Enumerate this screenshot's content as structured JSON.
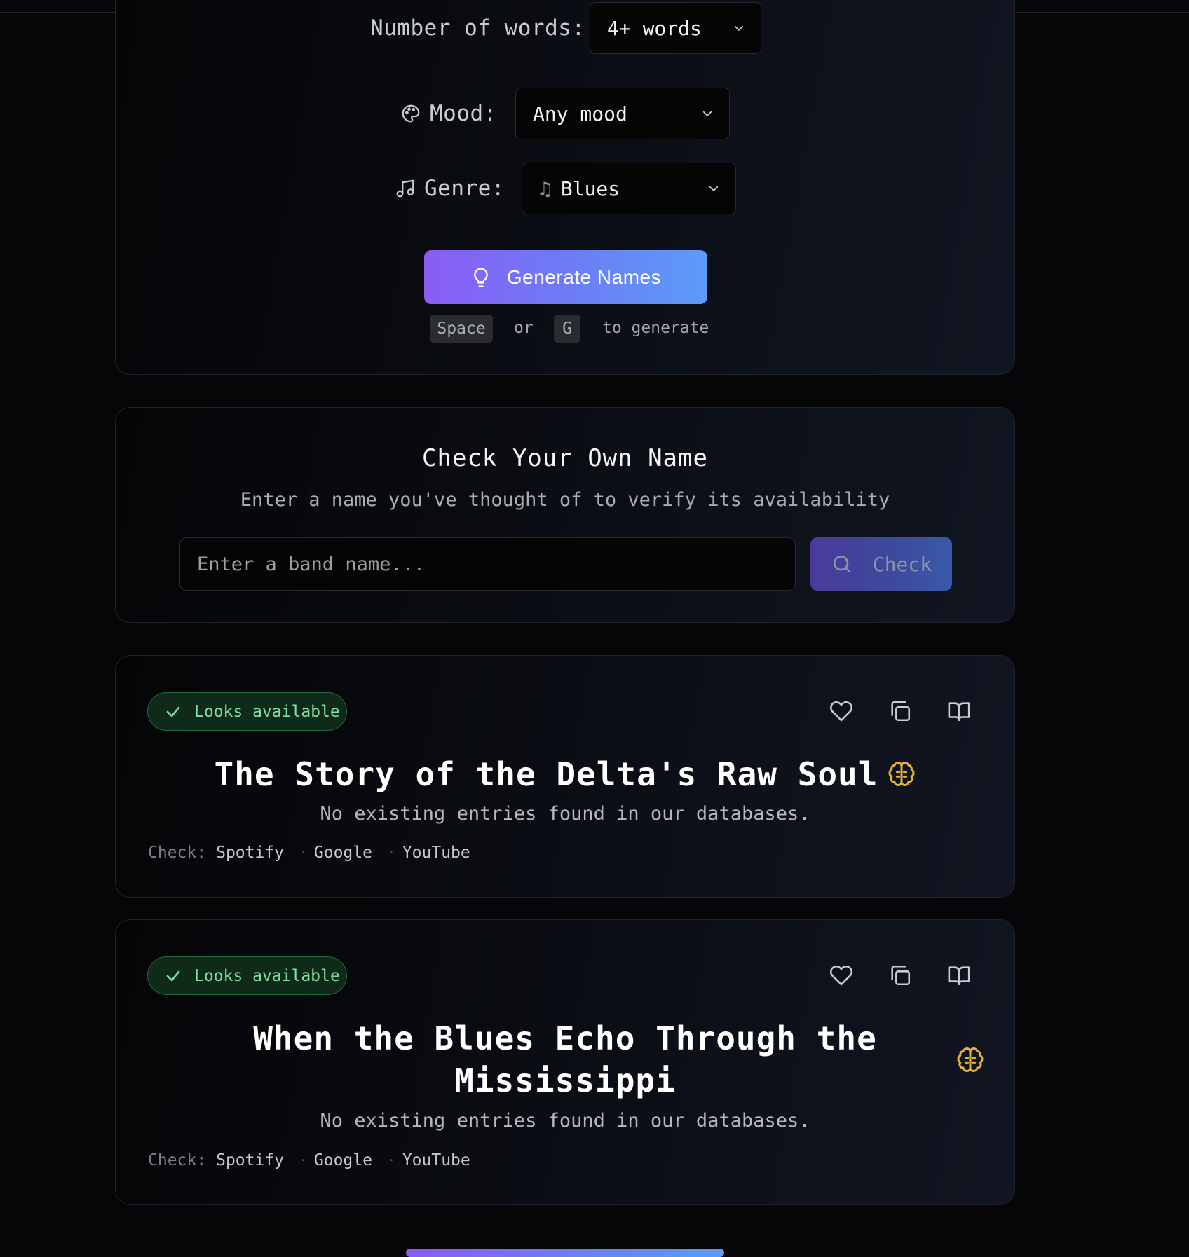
{
  "generator": {
    "words_label": "Number of words:",
    "words_value": "4+ words",
    "mood_label": "Mood:",
    "mood_value": "Any mood",
    "genre_label": "Genre:",
    "genre_value": "Blues",
    "generate_label": "Generate Names",
    "hint_key_1": "Space",
    "hint_or": "or",
    "hint_key_2": "G",
    "hint_tail": "to generate"
  },
  "check": {
    "title": "Check Your Own Name",
    "subtitle": "Enter a name you've thought of to verify its availability",
    "placeholder": "Enter a band name...",
    "button_label": "Check"
  },
  "results": [
    {
      "badge": "Looks available",
      "name": "The Story of the Delta's Raw Soul",
      "description": "No existing entries found in our databases.",
      "check_label": "Check:",
      "links": [
        "Spotify",
        "Google",
        "YouTube"
      ]
    },
    {
      "badge": "Looks available",
      "name_line_1": "When the Blues Echo Through the",
      "name_line_2": "Mississippi",
      "description": "No existing entries found in our databases.",
      "check_label": "Check:",
      "links": [
        "Spotify",
        "Google",
        "YouTube"
      ]
    }
  ],
  "icons": {
    "mood": "palette-icon",
    "genre": "music-note-icon",
    "generate": "lightbulb-icon",
    "check": "search-icon",
    "badge": "check-icon",
    "favorite": "heart-icon",
    "copy": "copy-icon",
    "details": "book-open-icon",
    "ai": "brain-icon"
  },
  "colors": {
    "accent_start": "#8b5cf6",
    "accent_end": "#5b9cf8",
    "available_green": "#7ee0a0",
    "brain_gold": "#e5b23a"
  }
}
